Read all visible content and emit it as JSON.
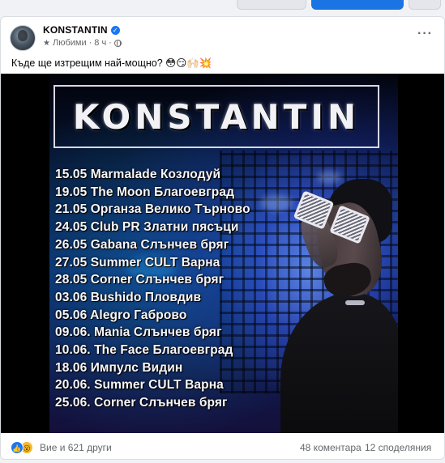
{
  "post": {
    "author": "KONSTANTIN",
    "audience": "Любими",
    "time": "8 ч",
    "caption": "Къде ще изтрещим най-мощно? 😳😏🙌🏻💥"
  },
  "poster": {
    "title": "KONSTANTIN",
    "tour_dates": [
      "15.05 Marmalade Козлодуй",
      "19.05 The Moon Благоевград",
      "21.05 Органза Велико Търново",
      "24.05 Club PR Златни пясъци",
      "26.05 Gabana Слънчев бряг",
      "27.05 Summer CULT Варна",
      "28.05 Corner Слънчев бряг",
      "03.06 Bushido Пловдив",
      "05.06 Alegro Габрово",
      "09.06. Mania Слънчев бряг",
      "10.06. The Face Благоевград",
      "18.06 Импулс Видин",
      "20.06. Summer CULT Варна",
      "25.06. Corner Слънчев бряг"
    ]
  },
  "reactions": {
    "like_icon": "👍",
    "wow_icon": "😮",
    "summary": "Вие и 621 други",
    "comments": "48 коментара",
    "shares": "12 споделяния"
  },
  "colors": {
    "accent": "#1877f2",
    "secondary_text": "#65676b"
  },
  "icons": [
    "verified-badge-icon",
    "favorites-star-icon",
    "globe-icon",
    "more-options-icon",
    "like-reaction-icon",
    "wow-reaction-icon"
  ]
}
